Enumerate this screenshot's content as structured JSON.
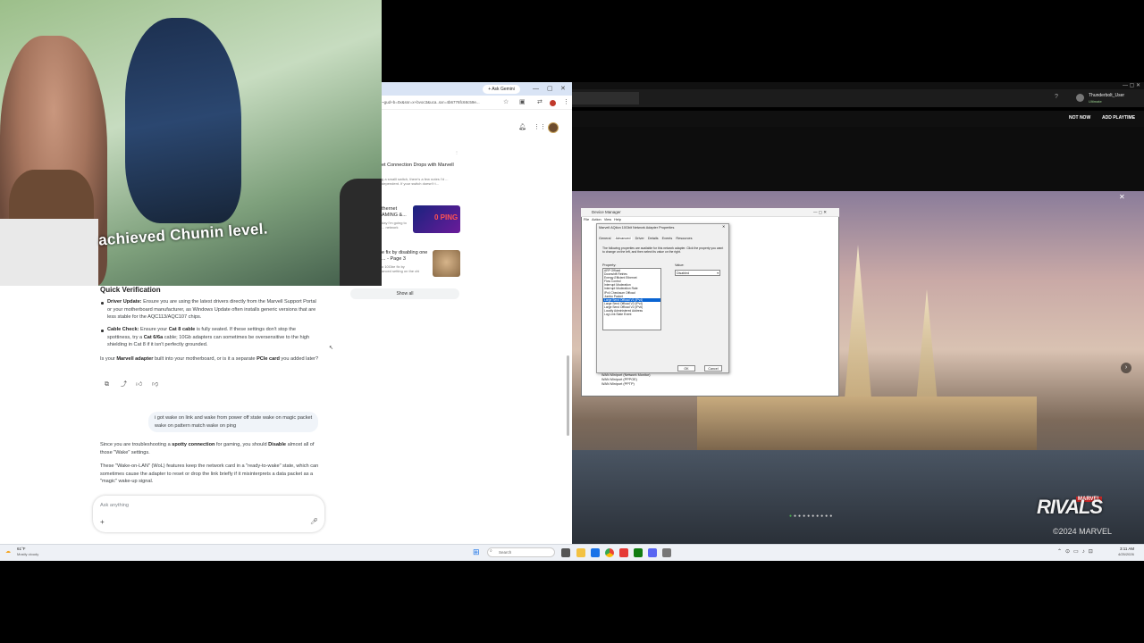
{
  "chrome": {
    "ask_gemini": "+ Ask Gemini",
    "url": "~gud+b=0x&ssr=x+bvoc3&uca..sxr=4b6776fc68c59e...",
    "results": [
      {
        "title": "et Connection Drops with Marvell",
        "sub": "g a smalll switch, there's a few notes I'd ... dependent. If your switch doesn't t..."
      },
      {
        "title": "thernet\nAMING &...",
        "sub": "day i'm going to\n... network"
      },
      {
        "title": "e fix by disabling one\n... - Page 3",
        "sub": "o 10Gbe fix by\nanced setting on the chi"
      }
    ],
    "thumb_text": "0 PING",
    "show_all": "Show all"
  },
  "chat": {
    "heading": "Quick Verification",
    "driver_label": "Driver Update:",
    "driver_text": " Ensure you are using the latest drivers directly from the Marvell Support Portal or your motherboard manufacturer, as Windows Update often installs generic versions that are less stable for the AQC113/AQC107 chips.",
    "cable_label": "Cable Check:",
    "cable_text_1": " Ensure your ",
    "cable_b1": "Cat 8 cable",
    "cable_text_2": " is fully seated. If these settings don't stop the spottiness, try a ",
    "cable_b2": "Cat 6/6a",
    "cable_text_3": " cable; 10Gb adapters can sometimes be oversensitive to the high shielding in Cat 8 if it isn't perfectly grounded.",
    "question_1": "Is your ",
    "question_b1": "Marvell adapter",
    "question_2": " built into your motherboard, or is it a separate ",
    "question_b2": "PCIe card",
    "question_3": " you added later?",
    "user_msg": "i got wake on link and wake from power off state wake on magic packet wake on pattern match wake on ping",
    "reply1_1": "Since you are troubleshooting a ",
    "reply1_b1": "spotty connection",
    "reply1_2": " for gaming, you should ",
    "reply1_b2": "Disable",
    "reply1_3": " almost all of those \"Wake\" settings.",
    "reply2": "These \"Wake-on-LAN\" (WoL) features keep the network card in a \"ready-to-wake\" state, which can sometimes cause the adapter to reset or drop the link briefly if it misinterprets a data packet as a \"magic\" wake-up signal.",
    "input_placeholder": "Ask anything"
  },
  "webcam": {
    "caption": "achieved Chunin level."
  },
  "xbox": {
    "user": "Thunderbolt_User",
    "tier": "Ultimate",
    "not_now": "NOT NOW",
    "add_playtime": "ADD PLAYTIME"
  },
  "devmgr": {
    "title": "Device Manager",
    "menu": [
      "File",
      "Action",
      "View",
      "Help"
    ],
    "props_title": "Marvell AQtion 10Gbit Network Adapter Properties",
    "tabs": [
      "General",
      "Advanced",
      "Driver",
      "Details",
      "Events",
      "Resources"
    ],
    "desc": "The following properties are available for this network adapter. Click the property you want to change on the left, and then select its value on the right.",
    "property_label": "Property:",
    "value_label": "Value:",
    "properties": [
      "ARP Offload",
      "Downshift Retries",
      "Energy-Efficient Ethernet",
      "Flow Control",
      "Interrupt Moderation",
      "Interrupt Moderation Rate",
      "IPv4 Checksum Offload",
      "Jumbo Packet",
      "Large Send Offload V1 (IPv4)",
      "Large Send Offload V2 (IPv4)",
      "Large Send Offload V2 (IPv6)",
      "Locally Administered Address",
      "Log Link State Event"
    ],
    "selected_index": 8,
    "value": "Disabled",
    "ok": "OK",
    "cancel": "Cancel",
    "devices": [
      "WAN Miniport (Network Monitor)",
      "WAN Miniport (PPPOE)",
      "WAN Miniport (PPTP)"
    ]
  },
  "game": {
    "logo": "RIVALS",
    "marvel": "MARVEL",
    "copyright": "©2024 MARVEL"
  },
  "taskbar": {
    "weather_temp": "61°F",
    "weather_desc": "Mostly cloudy",
    "search": "Search",
    "time": "3:11 AM",
    "date": "4/25/2026"
  }
}
